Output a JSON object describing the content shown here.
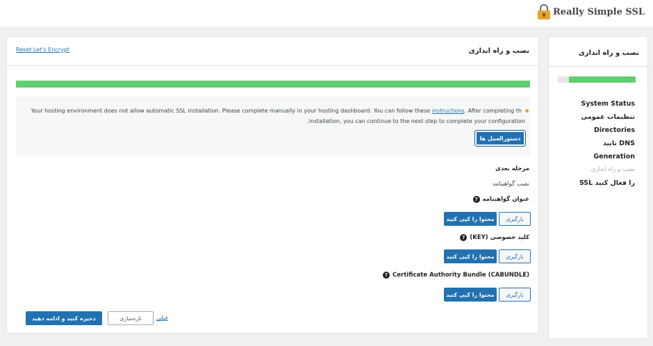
{
  "brand": {
    "name": "Really Simple SSL"
  },
  "sidebar": {
    "title": "نصب و راه اندازی",
    "progress_percent": 86,
    "items": [
      {
        "label": "System Status"
      },
      {
        "label": "تنظیمات عمومی"
      },
      {
        "label": "Directories"
      },
      {
        "label": "تایید DNS"
      },
      {
        "label": "Generation"
      },
      {
        "label": "نصب و راه اندازی"
      },
      {
        "label": "SSL را فعال کنید"
      }
    ]
  },
  "main": {
    "reset_link": "Reset Let's Encrypt",
    "title": "نصب و راه اندازی",
    "progress_percent": 100,
    "notice": {
      "line1_before": "Your hosting environment does not allow automatic SSL installation. Please complete manually in your hosting dashboard. You can follow these ",
      "line1_link": "instructions",
      "line1_after": ". After completing th",
      "line2": ".installation, you can continue to the next step to complete your configuration",
      "button": "دستورالعمل ها"
    },
    "next_step_label": "مرحله بعدی",
    "install_cert_label": "نصب گواهینامه",
    "sections": [
      {
        "label": "عنوان گواهینامه",
        "copy_button": "محتوا را کپی کنید",
        "download_button": "بارگیری"
      },
      {
        "label": "کلید خصوصی (KEY)",
        "copy_button": "محتوا را کپی کنید",
        "download_button": "بارگیری"
      },
      {
        "label": "Certificate Authority Bundle (CABUNDLE)",
        "copy_button": "محتوا را کپی کنید",
        "download_button": "بارگیری"
      }
    ],
    "footer": {
      "save_button": "ذخیره کنید و ادامه دهید",
      "refresh_button": "تازه‌سازی",
      "previous_link": "قبلی"
    }
  },
  "colors": {
    "accent": "#2271b1",
    "progress": "#61ce70",
    "warning_dot": "#e3a72f"
  }
}
